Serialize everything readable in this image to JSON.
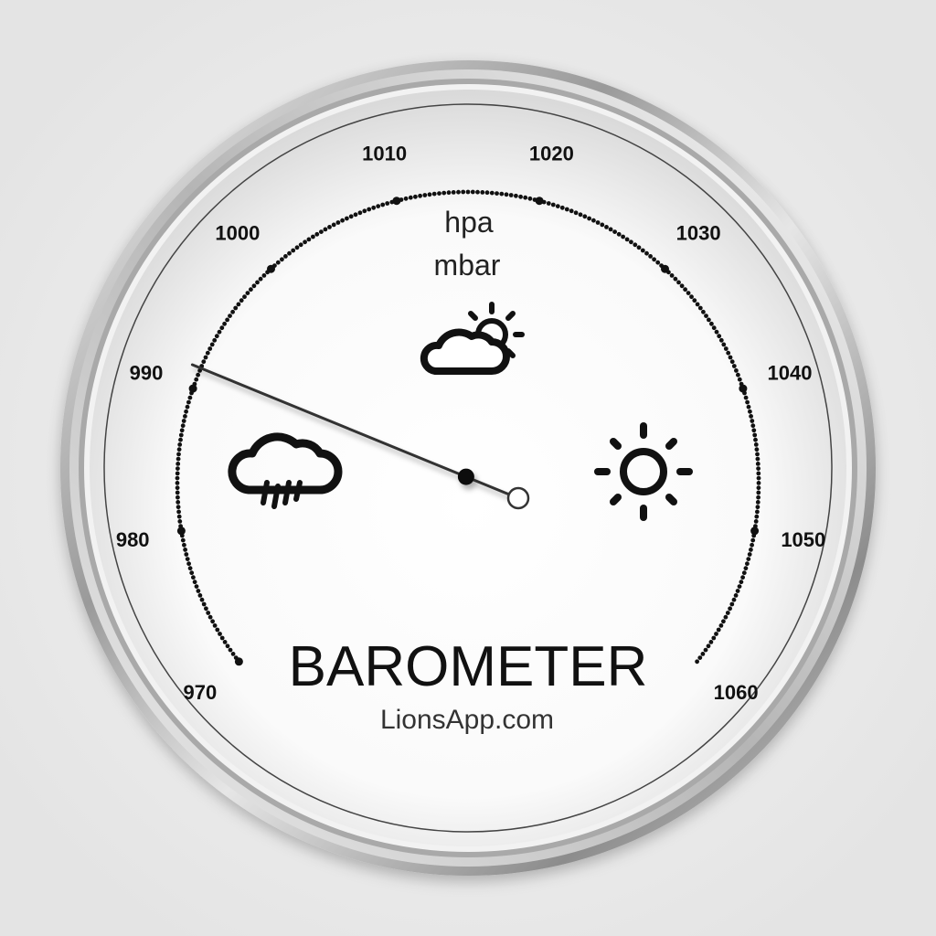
{
  "gauge": {
    "title": "BAROMETER",
    "brand": "LionsApp.com",
    "unit_primary": "hpa",
    "unit_secondary": "mbar",
    "scale_min": 970,
    "scale_max": 1060,
    "major_step": 10,
    "minor_step": 1,
    "tick_labels": [
      "970",
      "980",
      "990",
      "1000",
      "1010",
      "1020",
      "1030",
      "1040",
      "1050",
      "1060"
    ],
    "needle_value": 991.5,
    "weather_icons": [
      {
        "name": "rain-cloud-icon",
        "meaning": "rain"
      },
      {
        "name": "partly-cloudy-icon",
        "meaning": "change"
      },
      {
        "name": "sun-icon",
        "meaning": "fair"
      }
    ],
    "colors": {
      "bezel": "#b8b8b8",
      "face": "#ffffff",
      "ink": "#111111",
      "needle": "#333333"
    }
  }
}
